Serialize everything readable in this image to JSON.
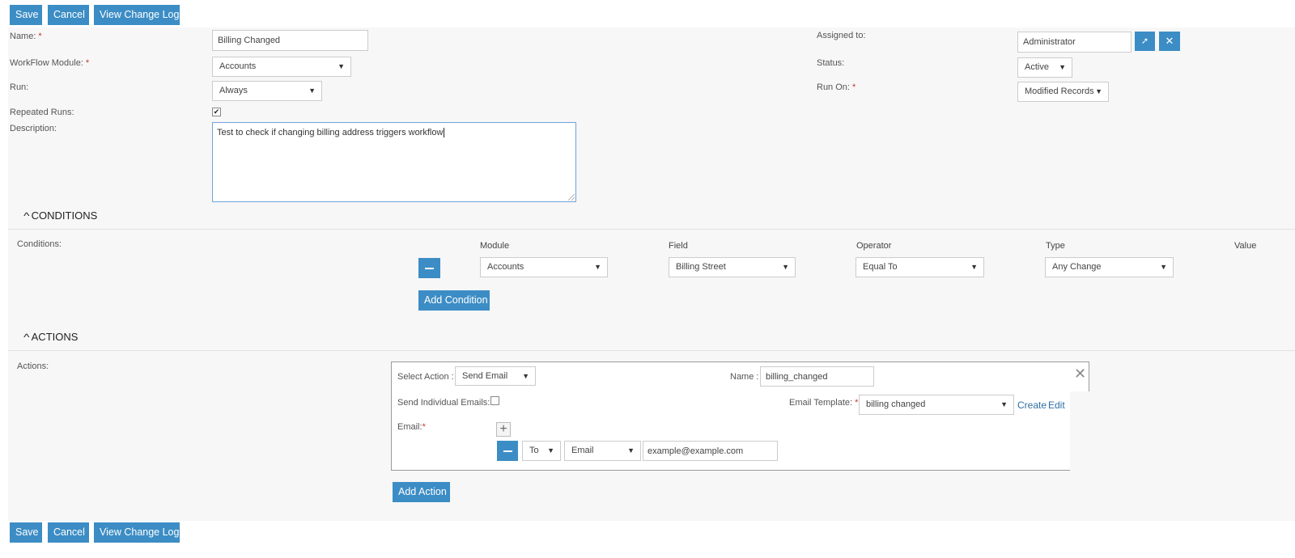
{
  "toolbar": {
    "save": "Save",
    "cancel": "Cancel",
    "change_log": "View Change Log"
  },
  "form": {
    "name": {
      "label": "Name:",
      "value": "Billing  Changed"
    },
    "module": {
      "label": "WorkFlow Module:",
      "value": "Accounts"
    },
    "run": {
      "label": "Run:",
      "value": "Always"
    },
    "repeated": {
      "label": "Repeated Runs:",
      "checked": true
    },
    "description": {
      "label": "Description:",
      "value": "Test to check if changing billing address triggers workflow"
    },
    "assigned": {
      "label": "Assigned to:",
      "value": "Administrator"
    },
    "status": {
      "label": "Status:",
      "value": "Active"
    },
    "run_on": {
      "label": "Run On:",
      "value": "Modified Records"
    },
    "required_mark": "*"
  },
  "conditions": {
    "heading": "CONDITIONS",
    "label": "Conditions:",
    "columns": [
      "Module",
      "Field",
      "Operator",
      "Type",
      "Value"
    ],
    "row": {
      "module": "Accounts",
      "field": "Billing Street",
      "operator": "Equal To",
      "type": "Any Change"
    },
    "add_label": "Add Condition"
  },
  "actions": {
    "heading": "ACTIONS",
    "label": "Actions:",
    "select_action_label": "Select Action :",
    "select_action_value": "Send Email",
    "name_label": "Name :",
    "name_value": "billing_changed",
    "individual_label": "Send Individual Emails:",
    "template_label": "Email Template:",
    "template_value": "billing  changed",
    "create_link": "Create",
    "edit_link": "Edit",
    "email_label": "Email:",
    "recipient_type": "To",
    "recipient_field": "Email",
    "recipient_value": "example@example.com",
    "add_label": "Add Action"
  },
  "colors": {
    "primary": "#3c8dc5",
    "required": "#c0392b",
    "link": "#2f6ea3"
  }
}
